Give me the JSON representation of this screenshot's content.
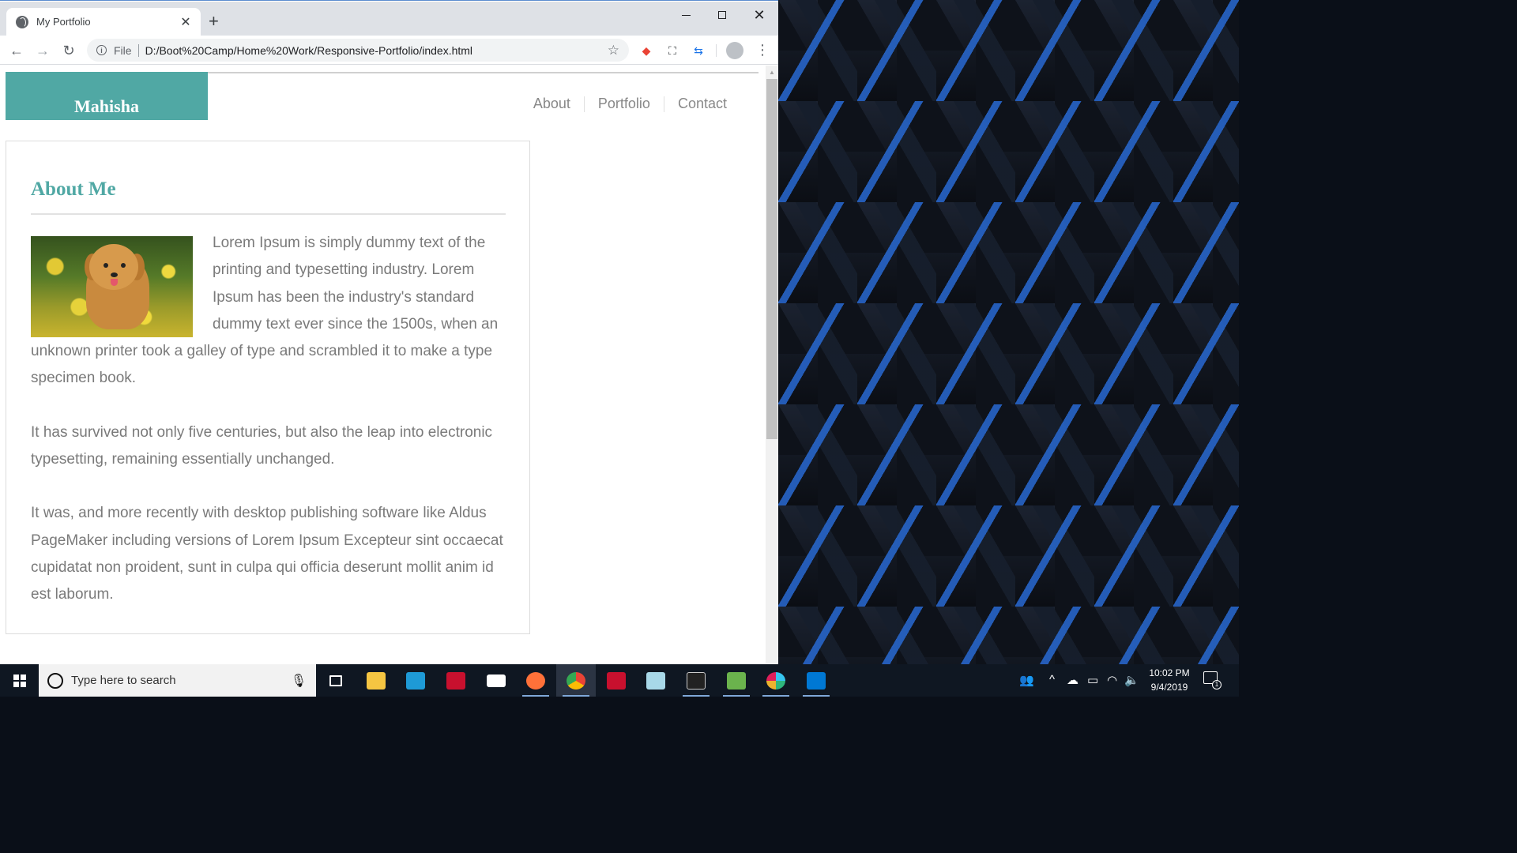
{
  "browser": {
    "tab_title": "My Portfolio",
    "new_tab_icon": "plus",
    "address": {
      "scheme_label": "File",
      "url": "D:/Boot%20Camp/Home%20Work/Responsive-Portfolio/index.html"
    }
  },
  "page": {
    "brand": "Mahisha",
    "nav": [
      {
        "label": "About"
      },
      {
        "label": "Portfolio"
      },
      {
        "label": "Contact"
      }
    ],
    "about": {
      "title": "About Me",
      "paragraphs": [
        "Lorem Ipsum is simply dummy text of the printing and typesetting industry. Lorem Ipsum has been the industry's standard dummy text ever since the 1500s, when an unknown printer took a galley of type and scrambled it to make a type specimen book.",
        "It has survived not only five centuries, but also the leap into electronic typesetting, remaining essentially unchanged.",
        "It was, and more recently with desktop publishing software like Aldus PageMaker including versions of Lorem Ipsum Excepteur sint occaecat cupidatat non proident, sunt in culpa qui officia deserunt mollit anim id est laborum."
      ]
    },
    "colors": {
      "accent": "#50a8a4",
      "body_text": "#7a7a7a"
    }
  },
  "taskbar": {
    "search_placeholder": "Type here to search",
    "apps": [
      "task-view",
      "file-explorer",
      "lexmark-l",
      "mcafee",
      "mail",
      "firefox",
      "chrome",
      "mcafee-alt",
      "notes",
      "terminal",
      "excel-like",
      "slack",
      "vscode"
    ],
    "clock_time": "10:02 PM",
    "clock_date": "9/4/2019",
    "notification_count": "1"
  }
}
